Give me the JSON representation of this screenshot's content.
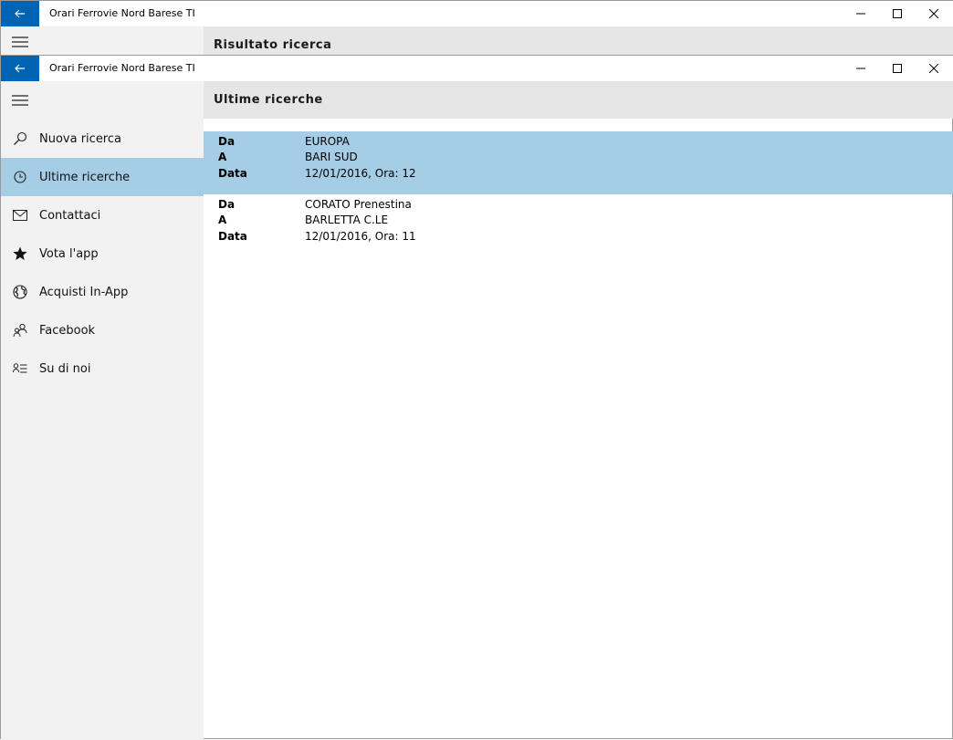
{
  "app_title": "Orari Ferrovie Nord Barese TI",
  "background_window": {
    "header_title": "Risultato ricerca"
  },
  "header": {
    "title": "Ultime ricerche"
  },
  "nav": {
    "items": [
      {
        "label": "Nuova ricerca",
        "icon": "search-icon"
      },
      {
        "label": "Ultime ricerche",
        "icon": "clock-icon"
      },
      {
        "label": "Contattaci",
        "icon": "mail-icon"
      },
      {
        "label": "Vota l'app",
        "icon": "star-icon"
      },
      {
        "label": "Acquisti In-App",
        "icon": "globe-icon"
      },
      {
        "label": "Facebook",
        "icon": "people-icon"
      },
      {
        "label": "Su di noi",
        "icon": "contact-info-icon"
      }
    ],
    "selected_index": 1
  },
  "results": [
    {
      "da_label": "Da",
      "da": "EUROPA",
      "a_label": "A",
      "a": "BARI SUD",
      "data_label": "Data",
      "data": "12/01/2016, Ora: 12"
    },
    {
      "da_label": "Da",
      "da": "CORATO Prenestina",
      "a_label": "A",
      "a": "BARLETTA C.LE",
      "data_label": "Data",
      "data": "12/01/2016, Ora: 11"
    }
  ],
  "colors": {
    "accent": "#0063b1",
    "selection": "#a6cde6",
    "sidebar_bg": "#f2f2f2",
    "header_bg": "#e6e6e6"
  }
}
